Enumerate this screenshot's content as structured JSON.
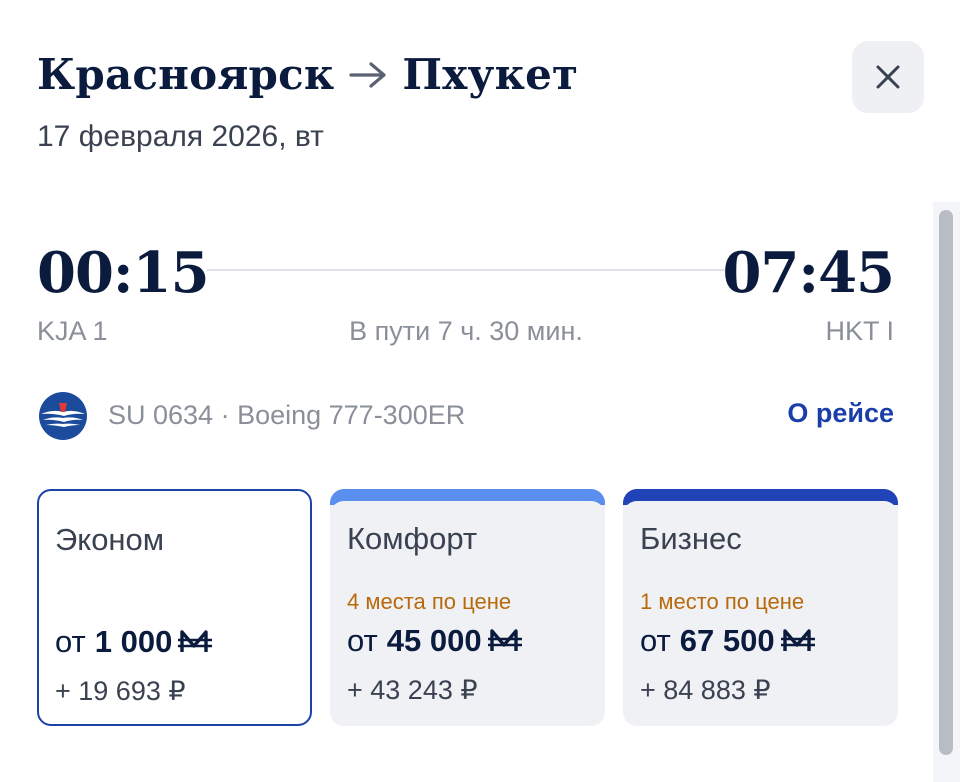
{
  "header": {
    "origin": "Красноярск",
    "destination": "Пхукет",
    "date": "17 февраля 2026, вт"
  },
  "flight": {
    "departure_time": "00:15",
    "arrival_time": "07:45",
    "departure_code": "KJA 1",
    "arrival_code": "HKT I",
    "duration": "В пути 7 ч. 30 мин.",
    "info": "SU 0634 · Boeing 777-300ER",
    "about_link": "О рейсе"
  },
  "fares": [
    {
      "name": "Эконом",
      "seats": "",
      "from": "от",
      "price": "1 000",
      "extra": "+ 19 693 ₽"
    },
    {
      "name": "Комфорт",
      "seats": "4 места по цене",
      "from": "от",
      "price": "45 000",
      "extra": "+ 43 243 ₽"
    },
    {
      "name": "Бизнес",
      "seats": "1 место по цене",
      "from": "от",
      "price": "67 500",
      "extra": "+ 84 883 ₽"
    }
  ],
  "icons": {
    "close": "close-icon",
    "arrow": "arrow-right-icon",
    "airline": "aeroflot-logo",
    "miles": "miles-currency-icon"
  },
  "colors": {
    "text_primary": "#0b1b3d",
    "link": "#1a3fa8",
    "accent_selected": "#1c43a6",
    "comfort_bar": "#5a8ff0",
    "business_bar": "#2044b8",
    "seats_warning": "#b86a0a",
    "card_bg": "#eff1f5"
  }
}
